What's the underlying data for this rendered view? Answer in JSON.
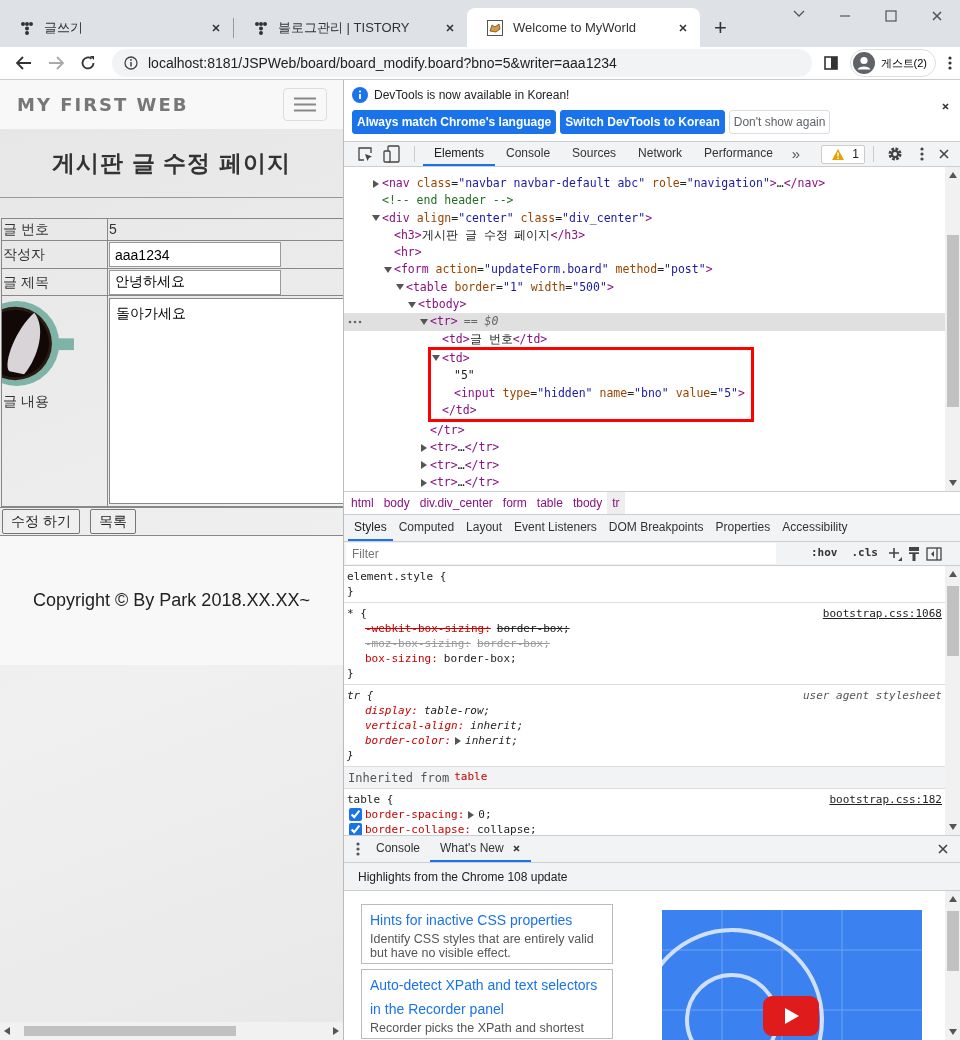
{
  "browser": {
    "tabs": [
      {
        "title": "글쓰기",
        "kind": "dots",
        "selected": false
      },
      {
        "title": "블로그관리 | TISTORY",
        "kind": "dots",
        "selected": false
      },
      {
        "title": "Welcome to MyWorld",
        "kind": "cat",
        "selected": true
      }
    ],
    "new_tab": "+",
    "address": "localhost:8181/JSPWeb/board/board_modify.board?bno=5&writer=aaa1234",
    "profile": "게스트(2)"
  },
  "page": {
    "brand": "MY FIRST WEB",
    "heading": "게시판 글 수정 페이지",
    "rows": [
      {
        "kind": "text",
        "label": "글 번호",
        "value": "5"
      },
      {
        "kind": "input",
        "label": "작성자",
        "value": "aaa1234"
      },
      {
        "kind": "input",
        "label": "글 제목",
        "value": "안녕하세요"
      },
      {
        "kind": "textarea",
        "label": "글 내용",
        "value": "돌아가세요"
      }
    ],
    "buttons": [
      "수정 하기",
      "목록"
    ],
    "footer": "Copyright © By Park 2018.XX.XX~"
  },
  "devtools": {
    "infobar": {
      "message": "DevTools is now available in Korean!",
      "buttons": [
        {
          "label": "Always match Chrome's language",
          "primary": true
        },
        {
          "label": "Switch DevTools to Korean",
          "primary": true
        },
        {
          "label": "Don't show again",
          "primary": false
        }
      ]
    },
    "tabs": [
      {
        "label": "Elements",
        "selected": true
      },
      {
        "label": "Console",
        "selected": false
      },
      {
        "label": "Sources",
        "selected": false
      },
      {
        "label": "Network",
        "selected": false
      },
      {
        "label": "Performance",
        "selected": false
      }
    ],
    "more_tabs": "»",
    "warnings": "1",
    "dom": [
      {
        "kind": "element",
        "text": "<nav class=\"navbar navbar-default abc\" role=\"navigation\">…</nav>",
        "expanded": false,
        "selected": false
      },
      {
        "kind": "comment",
        "text": "<!-- end header -->",
        "selected": false
      },
      {
        "kind": "element",
        "text": "<div align=\"center\" class=\"div_center\">",
        "expanded": true,
        "selected": false,
        "children": [
          {
            "kind": "element",
            "text": "<h3>게시판 글 수정 페이지</h3>",
            "selected": false
          },
          {
            "kind": "element",
            "text": "<hr>",
            "selected": false
          },
          {
            "kind": "element",
            "text": "<form action=\"updateForm.board\" method=\"post\">",
            "expanded": true,
            "selected": false,
            "children": [
              {
                "kind": "element",
                "text": "<table border=\"1\" width=\"500\">",
                "expanded": true,
                "selected": false,
                "children": [
                  {
                    "kind": "element",
                    "text": "<tbody>",
                    "expanded": true,
                    "selected": false,
                    "children": [
                      {
                        "kind": "element",
                        "text": "<tr>",
                        "suffix": "== $0",
                        "expanded": true,
                        "selected": true,
                        "close": "</tr>",
                        "children": [
                          {
                            "kind": "element",
                            "text": "<td>글 번호</td>",
                            "selected": false
                          },
                          {
                            "kind": "element",
                            "text": "<td>",
                            "expanded": true,
                            "selected": false,
                            "outlined": true,
                            "close": "</td>",
                            "children": [
                              {
                                "kind": "text",
                                "text": "\"5\"",
                                "selected": false
                              },
                              {
                                "kind": "element",
                                "text": "<input type=\"hidden\" name=\"bno\" value=\"5\">",
                                "selected": false
                              }
                            ]
                          }
                        ]
                      },
                      {
                        "kind": "element",
                        "text": "<tr>…</tr>",
                        "expanded": false,
                        "selected": false
                      },
                      {
                        "kind": "element",
                        "text": "<tr>…</tr>",
                        "expanded": false,
                        "selected": false
                      },
                      {
                        "kind": "element",
                        "text": "<tr>…</tr>",
                        "expanded": false,
                        "selected": false
                      }
                    ]
                  }
                ]
              }
            ]
          }
        ]
      }
    ],
    "breadcrumbs": [
      {
        "label": "html",
        "selected": false
      },
      {
        "label": "body",
        "selected": false
      },
      {
        "label": "div.div_center",
        "selected": false
      },
      {
        "label": "form",
        "selected": false
      },
      {
        "label": "table",
        "selected": false
      },
      {
        "label": "tbody",
        "selected": false
      },
      {
        "label": "tr",
        "selected": true
      }
    ],
    "style_tabs": [
      {
        "label": "Styles",
        "selected": true
      },
      {
        "label": "Computed",
        "selected": false
      },
      {
        "label": "Layout",
        "selected": false
      },
      {
        "label": "Event Listeners",
        "selected": false
      },
      {
        "label": "DOM Breakpoints",
        "selected": false
      },
      {
        "label": "Properties",
        "selected": false
      },
      {
        "label": "Accessibility",
        "selected": false
      }
    ],
    "filter": {
      "placeholder": "Filter"
    },
    "toggles": [
      ":hov",
      ".cls"
    ],
    "rules": [
      {
        "kind": "rule",
        "selector": "element.style {",
        "close": "}"
      },
      {
        "kind": "rule",
        "selector": "* {",
        "source": "bootstrap.css:1068",
        "props": [
          {
            "name": "-webkit-box-sizing:",
            "value": "border-box;",
            "kind": "overridden"
          },
          {
            "name": "-moz-box-sizing:",
            "value": "border-box;",
            "kind": "invalid"
          },
          {
            "name": "box-sizing:",
            "value": "border-box;",
            "kind": "active"
          }
        ],
        "close": "}"
      },
      {
        "kind": "rule",
        "selector": "tr {",
        "source": "user agent stylesheet",
        "user_agent": true,
        "props": [
          {
            "name": "display:",
            "value": "table-row;",
            "kind": "active"
          },
          {
            "name": "vertical-align:",
            "value": "inherit;",
            "kind": "active"
          },
          {
            "name": "border-color:",
            "value": "inherit;",
            "kind": "active",
            "expandable": true
          }
        ],
        "close": "}"
      },
      {
        "kind": "inherited",
        "label": "Inherited from",
        "element": "table"
      },
      {
        "kind": "rule",
        "selector": "table {",
        "source": "bootstrap.css:182",
        "props": [
          {
            "name": "border-spacing:",
            "value": "0;",
            "kind": "active",
            "expandable": true,
            "checked": true
          },
          {
            "name": "border-collapse:",
            "value": "collapse;",
            "kind": "active",
            "checked": true
          }
        ]
      }
    ],
    "drawer": {
      "tabs": [
        {
          "label": "Console",
          "selected": false,
          "closable": false
        },
        {
          "label": "What's New",
          "selected": true,
          "closable": true
        }
      ],
      "banner": "Highlights from the Chrome 108 update",
      "cards": [
        {
          "title": "Hints for inactive CSS properties",
          "description": "Identify CSS styles that are entirely valid but have no visible effect."
        },
        {
          "title": "Auto-detect XPath and text selectors in the Recorder panel",
          "description": "Recorder picks the XPath and shortest"
        }
      ]
    }
  }
}
